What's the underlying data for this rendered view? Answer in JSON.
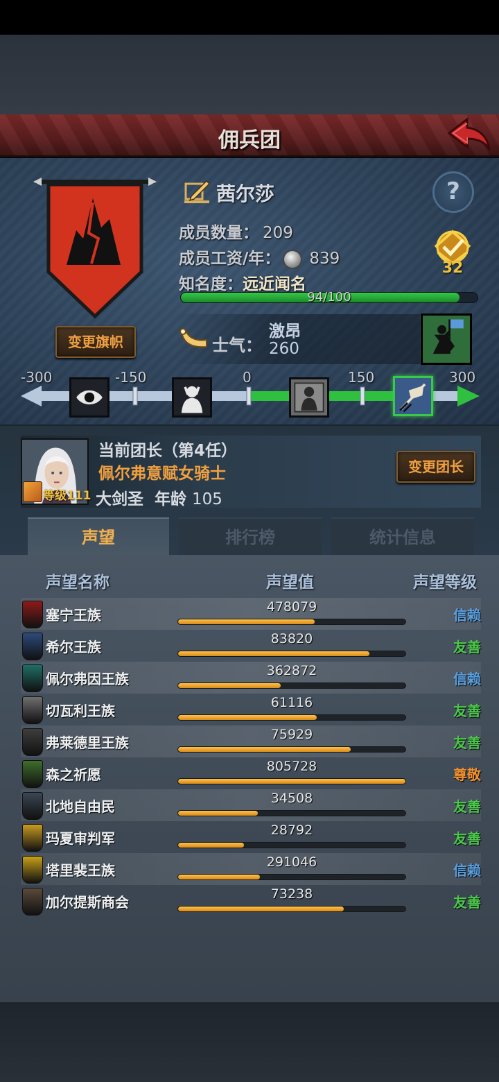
{
  "header": {
    "title": "佣兵团"
  },
  "company": {
    "name": "茜尔莎",
    "members_label": "成员数量：",
    "members": "209",
    "wage_label": "成员工资/年：",
    "wage": "839",
    "fame_label": "知名度：",
    "fame_rank": "远近闻名",
    "fame_progress": "94/100",
    "fame_fraction": 0.94,
    "rank_badge": "32",
    "change_flag_label": "变更旗帜",
    "help_label": "?"
  },
  "morale": {
    "label": "士气：",
    "state": "激昂",
    "value": "260",
    "scale_ticks": [
      "-300",
      "-150",
      "0",
      "150",
      "300"
    ],
    "scale_min": -300,
    "scale_max": 300,
    "current": 260
  },
  "leader": {
    "title": "当前团长（第4任）",
    "name": "佩尔弗意赋女骑士",
    "level": "等级111",
    "class_name": "大剑圣",
    "age_label": "年龄",
    "age": "105",
    "change_label": "变更团长"
  },
  "tabs": [
    {
      "label": "声望",
      "active": true
    },
    {
      "label": "排行榜",
      "active": false
    },
    {
      "label": "统计信息",
      "active": false
    }
  ],
  "table": {
    "headers": {
      "name": "声望名称",
      "value": "声望值",
      "level": "声望等级"
    },
    "rows": [
      {
        "name": "塞宁王族",
        "value": "478079",
        "fill": 0.6,
        "level": "信赖",
        "level_color": "#5aa0e0",
        "icon_color": "#8c1a1a"
      },
      {
        "name": "希尔王族",
        "value": "83820",
        "fill": 0.84,
        "level": "友善",
        "level_color": "#4cc84c",
        "icon_color": "#2c4a7a"
      },
      {
        "name": "佩尔弗因王族",
        "value": "362872",
        "fill": 0.45,
        "level": "信赖",
        "level_color": "#5aa0e0",
        "icon_color": "#1e6e66"
      },
      {
        "name": "切瓦利王族",
        "value": "61116",
        "fill": 0.61,
        "level": "友善",
        "level_color": "#4cc84c",
        "icon_color": "#6e6e6e"
      },
      {
        "name": "弗莱德里王族",
        "value": "75929",
        "fill": 0.76,
        "level": "友善",
        "level_color": "#4cc84c",
        "icon_color": "#3e3e3e"
      },
      {
        "name": "森之祈愿",
        "value": "805728",
        "fill": 1.0,
        "level": "尊敬",
        "level_color": "#f09030",
        "icon_color": "#3e6e2a"
      },
      {
        "name": "北地自由民",
        "value": "34508",
        "fill": 0.35,
        "level": "友善",
        "level_color": "#4cc84c",
        "icon_color": "#3a4654"
      },
      {
        "name": "玛夏审判军",
        "value": "28792",
        "fill": 0.29,
        "level": "友善",
        "level_color": "#4cc84c",
        "icon_color": "#c89a20"
      },
      {
        "name": "塔里裴王族",
        "value": "291046",
        "fill": 0.36,
        "level": "信赖",
        "level_color": "#5aa0e0",
        "icon_color": "#c8a018"
      },
      {
        "name": "加尔提斯商会",
        "value": "73238",
        "fill": 0.73,
        "level": "友善",
        "level_color": "#4cc84c",
        "icon_color": "#5a4a3a"
      }
    ]
  }
}
